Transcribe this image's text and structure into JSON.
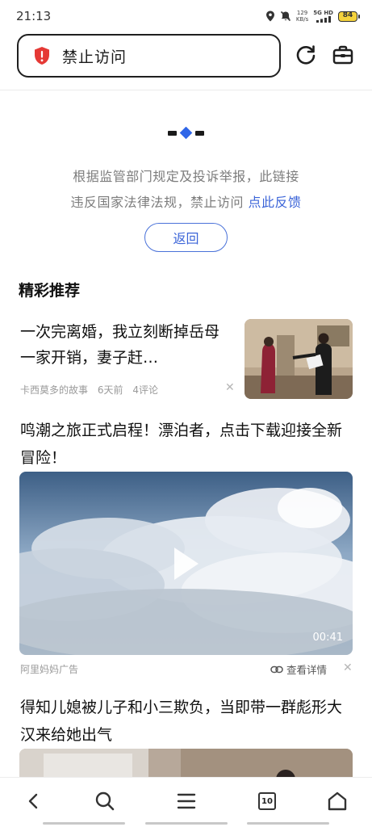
{
  "status_bar": {
    "time": "21:13",
    "net_speed_value": "129",
    "net_speed_unit": "KB/s",
    "network": "5G HD",
    "battery": "84"
  },
  "url_bar": {
    "title": "禁止访问"
  },
  "blocked": {
    "message_line1": "根据监管部门规定及投诉举报，此链接",
    "message_line2": "违反国家法律法规，禁止访问",
    "feedback_link": "点此反馈",
    "back_button": "返回"
  },
  "recommend": {
    "section_title": "精彩推荐",
    "articles": [
      {
        "title": "一次完离婚，我立刻断掉岳母一家开销，妻子赶…",
        "source": "卡西莫多的故事",
        "time": "6天前",
        "comments": "4评论"
      },
      {
        "title": "鸣潮之旅正式启程！漂泊者，点击下载迎接全新冒险！",
        "duration": "00:41",
        "ad_label": "阿里妈妈广告",
        "detail_link": "查看详情"
      },
      {
        "title": "得知儿媳被儿子和小三欺负，当即带一群彪形大汉来给她出气"
      }
    ]
  },
  "bottom_nav": {
    "tab_count": "10"
  },
  "colors": {
    "accent": "#3b64d8",
    "warning": "#e53935",
    "text_secondary": "#7c7c7c"
  }
}
